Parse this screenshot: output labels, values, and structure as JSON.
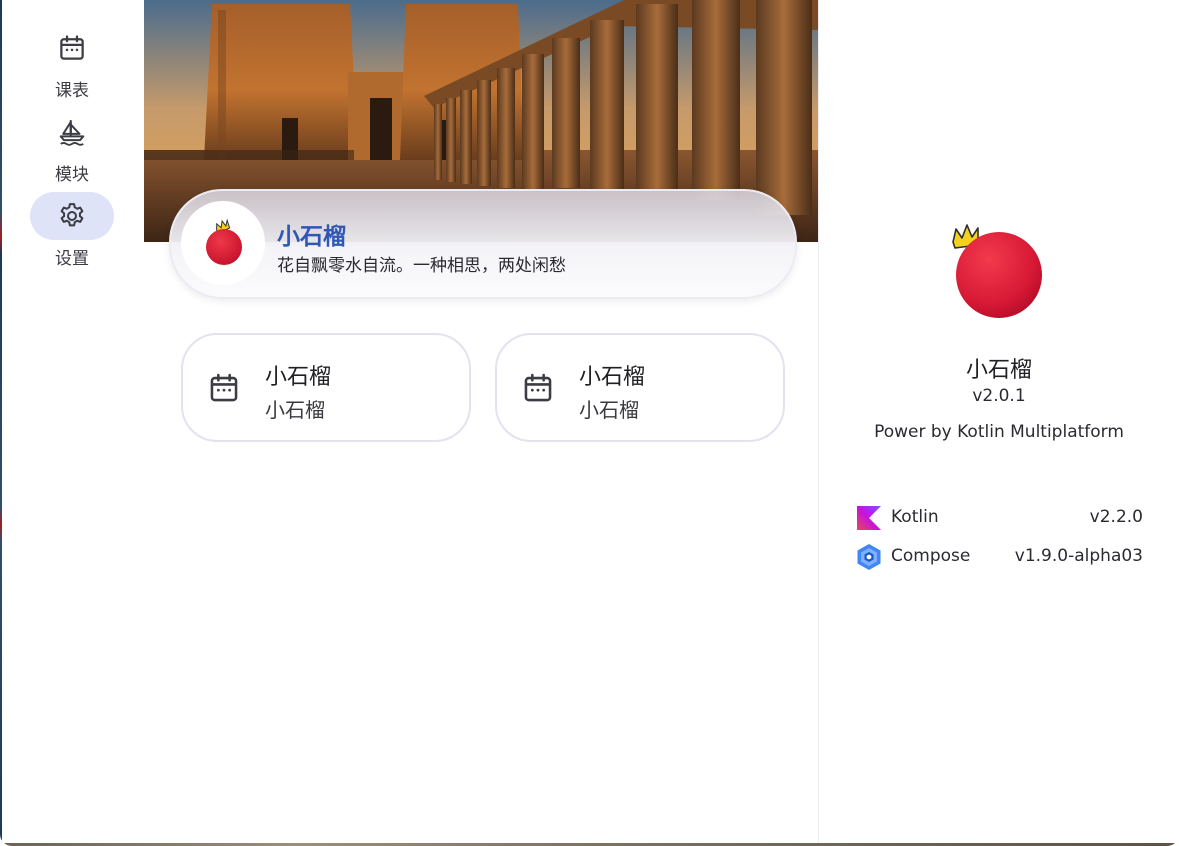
{
  "nav": {
    "items": [
      {
        "label": "课表",
        "icon": "calendar-icon",
        "active": false
      },
      {
        "label": "模块",
        "icon": "sailboat-icon",
        "active": false
      },
      {
        "label": "设置",
        "icon": "gear-icon",
        "active": true
      }
    ],
    "active_color": "#dfe3f7"
  },
  "profile": {
    "name": "小石榴",
    "motto": "花自飘零水自流。一种相思，两处闲愁",
    "name_color": "#2f57b4",
    "avatar_icon": "pomegranate-icon"
  },
  "quick_cards": [
    {
      "icon": "calendar-icon",
      "title": "小石榴",
      "subtitle": "小石榴"
    },
    {
      "icon": "calendar-icon",
      "title": "小石榴",
      "subtitle": "小石榴"
    }
  ],
  "about": {
    "app_name": "小石榴",
    "version": "v2.0.1",
    "powered_by": "Power by Kotlin Multiplatform",
    "logo_icon": "pomegranate-icon",
    "libraries": [
      {
        "name": "Kotlin",
        "version": "v2.2.0",
        "icon": "kotlin-logo-icon"
      },
      {
        "name": "Compose",
        "version": "v1.9.0-alpha03",
        "icon": "compose-logo-icon"
      }
    ]
  }
}
